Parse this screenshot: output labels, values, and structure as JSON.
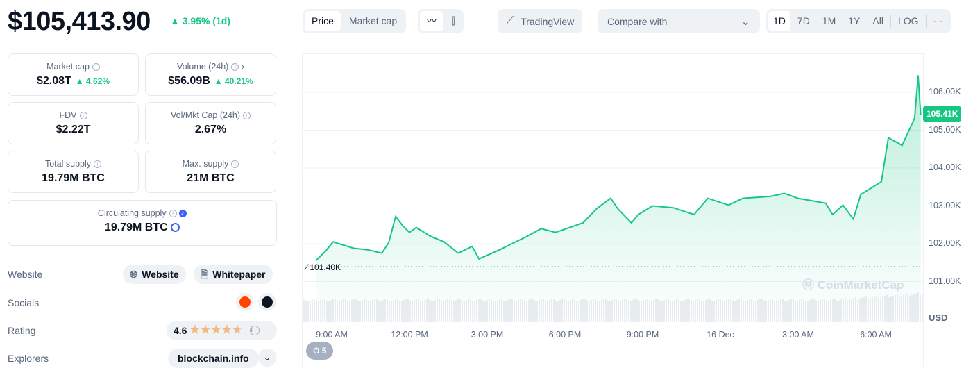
{
  "price": "$105,413.90",
  "price_change": "3.95% (1d)",
  "stats": [
    {
      "label": "Market cap",
      "value": "$2.08T",
      "change": "4.62%"
    },
    {
      "label": "Volume (24h)",
      "value": "$56.09B",
      "change": "40.21%"
    },
    {
      "label": "FDV",
      "value": "$2.22T"
    },
    {
      "label": "Vol/Mkt Cap (24h)",
      "value": "2.67%"
    },
    {
      "label": "Total supply",
      "value": "19.79M BTC"
    },
    {
      "label": "Max. supply",
      "value": "21M BTC"
    },
    {
      "label": "Circulating supply",
      "value": "19.79M BTC"
    }
  ],
  "links": {
    "website_label": "Website",
    "website_btn": "Website",
    "whitepaper_btn": "Whitepaper",
    "socials_label": "Socials",
    "rating_label": "Rating",
    "rating": "4.6",
    "rating_value": 4.6,
    "explorers_label": "Explorers",
    "explorer": "blockchain.info"
  },
  "toolbar": {
    "price": "Price",
    "market_cap": "Market cap",
    "tradingview": "TradingView",
    "compare": "Compare with",
    "ranges": [
      "1D",
      "7D",
      "1M",
      "1Y",
      "All"
    ],
    "log": "LOG",
    "more": "···",
    "selected_range": "1D"
  },
  "colors": {
    "up": "#16c784",
    "accent": "#3861fb"
  },
  "chart_data": {
    "type": "area",
    "currency": "USD",
    "ylim": [
      100.6,
      106.8
    ],
    "y_ticks": [
      "106.00K",
      "105.00K",
      "104.00K",
      "103.00K",
      "102.00K",
      "101.00K"
    ],
    "y_tick_values": [
      106,
      105,
      104,
      103,
      102,
      101
    ],
    "x_ticks": [
      "9:00 AM",
      "12:00 PM",
      "3:00 PM",
      "6:00 PM",
      "9:00 PM",
      "16 Dec",
      "3:00 AM",
      "6:00 AM"
    ],
    "open_label": "101.40K",
    "open_value": 101.4,
    "current_label": "105.41K",
    "unit": "K USD",
    "watermark": "CoinMarketCap",
    "events_badge": "5",
    "points": [
      [
        "15 Dec 08:23",
        101.55
      ],
      [
        "15 Dec 08:47",
        101.82
      ],
      [
        "15 Dec 09:03",
        102.05
      ],
      [
        "15 Dec 09:51",
        101.88
      ],
      [
        "15 Dec 10:23",
        101.84
      ],
      [
        "15 Dec 10:56",
        101.75
      ],
      [
        "15 Dec 11:12",
        102.03
      ],
      [
        "15 Dec 11:28",
        102.72
      ],
      [
        "15 Dec 11:44",
        102.48
      ],
      [
        "15 Dec 12:00",
        102.3
      ],
      [
        "15 Dec 12:16",
        102.43
      ],
      [
        "15 Dec 12:48",
        102.2
      ],
      [
        "15 Dec 13:20",
        102.05
      ],
      [
        "15 Dec 13:53",
        101.75
      ],
      [
        "15 Dec 14:25",
        101.93
      ],
      [
        "15 Dec 14:41",
        101.6
      ],
      [
        "15 Dec 15:29",
        101.84
      ],
      [
        "15 Dec 16:01",
        102.02
      ],
      [
        "15 Dec 16:33",
        102.2
      ],
      [
        "15 Dec 17:05",
        102.4
      ],
      [
        "15 Dec 17:38",
        102.3
      ],
      [
        "15 Dec 18:42",
        102.55
      ],
      [
        "15 Dec 19:14",
        102.93
      ],
      [
        "15 Dec 19:46",
        103.2
      ],
      [
        "15 Dec 20:02",
        102.93
      ],
      [
        "15 Dec 20:34",
        102.55
      ],
      [
        "15 Dec 20:50",
        102.77
      ],
      [
        "15 Dec 21:23",
        103.0
      ],
      [
        "15 Dec 22:11",
        102.95
      ],
      [
        "15 Dec 22:59",
        102.77
      ],
      [
        "15 Dec 23:31",
        103.2
      ],
      [
        "16 Dec 00:19",
        103.02
      ],
      [
        "16 Dec 00:52",
        103.2
      ],
      [
        "16 Dec 01:56",
        103.25
      ],
      [
        "16 Dec 02:28",
        103.33
      ],
      [
        "16 Dec 03:00",
        103.2
      ],
      [
        "16 Dec 04:04",
        103.07
      ],
      [
        "16 Dec 04:20",
        102.77
      ],
      [
        "16 Dec 04:44",
        103.02
      ],
      [
        "16 Dec 05:08",
        102.65
      ],
      [
        "16 Dec 05:25",
        103.3
      ],
      [
        "16 Dec 06:13",
        103.64
      ],
      [
        "16 Dec 06:29",
        104.8
      ],
      [
        "16 Dec 07:01",
        104.6
      ],
      [
        "16 Dec 07:30",
        105.32
      ],
      [
        "16 Dec 07:38",
        106.45
      ],
      [
        "16 Dec 07:44",
        105.41
      ]
    ]
  }
}
